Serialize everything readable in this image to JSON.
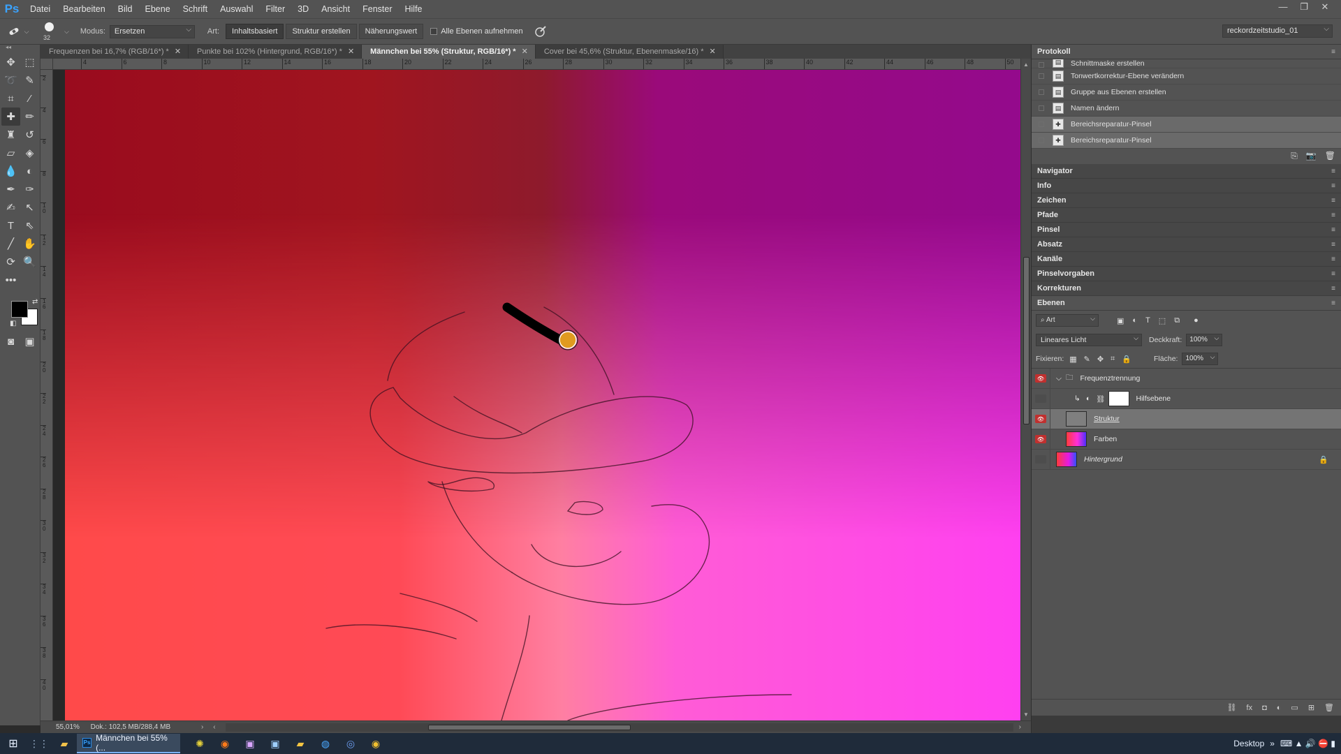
{
  "app": {
    "logo": "Ps"
  },
  "menu": [
    "Datei",
    "Bearbeiten",
    "Bild",
    "Ebene",
    "Schrift",
    "Auswahl",
    "Filter",
    "3D",
    "Ansicht",
    "Fenster",
    "Hilfe"
  ],
  "window_controls": [
    "—",
    "❐",
    "✕"
  ],
  "options": {
    "brush_size": "32",
    "mode_label": "Modus:",
    "mode_value": "Ersetzen",
    "type_label": "Art:",
    "type_buttons": [
      "Inhaltsbasiert",
      "Struktur erstellen",
      "Näherungswert"
    ],
    "active_type": "Inhaltsbasiert",
    "sample_all_label": "Alle Ebenen aufnehmen",
    "workspace": "reckordzeitstudio_01"
  },
  "tabs": [
    {
      "label": "Frequenzen bei 16,7% (RGB/16*) *",
      "active": false
    },
    {
      "label": "Punkte bei 102% (Hintergrund, RGB/16*) *",
      "active": false
    },
    {
      "label": "Männchen bei 55% (Struktur, RGB/16*) *",
      "active": true
    },
    {
      "label": "Cover bei 45,6% (Struktur, Ebenenmaske/16) *",
      "active": false
    }
  ],
  "ruler_h": [
    "4",
    "6",
    "8",
    "10",
    "12",
    "14",
    "16",
    "18",
    "20",
    "22",
    "24",
    "26",
    "28",
    "30",
    "32",
    "34",
    "36",
    "38",
    "40",
    "42",
    "44",
    "46",
    "48",
    "50"
  ],
  "ruler_v": [
    "2",
    "4",
    "6",
    "8",
    "10",
    "12",
    "14",
    "16",
    "18",
    "20",
    "22",
    "24",
    "26",
    "28",
    "30",
    "32",
    "34",
    "36",
    "38",
    "40"
  ],
  "status": {
    "zoom": "55,01%",
    "doc": "Dok.: 102,5 MB/288,4 MB"
  },
  "history": {
    "title": "Protokoll",
    "items": [
      {
        "label": "Schnittmaske erstellen",
        "selected": false
      },
      {
        "label": "Tonwertkorrektur-Ebene verändern",
        "selected": false
      },
      {
        "label": "Gruppe aus Ebenen erstellen",
        "selected": false
      },
      {
        "label": "Namen ändern",
        "selected": false
      },
      {
        "label": "Bereichsreparatur-Pinsel",
        "selected": true
      },
      {
        "label": "Bereichsreparatur-Pinsel",
        "selected": true
      }
    ]
  },
  "collapsed_panels": [
    "Navigator",
    "Info",
    "Zeichen",
    "Pfade",
    "Pinsel",
    "Absatz",
    "Kanäle",
    "Pinselvorgaben",
    "Korrekturen"
  ],
  "layers": {
    "title": "Ebenen",
    "filter": "Art",
    "blend_mode": "Lineares Licht",
    "opacity_label": "Deckkraft:",
    "opacity": "100%",
    "lock_label": "Fixieren:",
    "fill_label": "Fläche:",
    "fill": "100%",
    "items": [
      {
        "name": "Frequenztrennung",
        "kind": "group",
        "visible": true,
        "selected": false
      },
      {
        "name": "Hilfsebene",
        "kind": "adjustment",
        "visible": false,
        "selected": false
      },
      {
        "name": "Struktur",
        "kind": "pixel",
        "visible": true,
        "selected": true
      },
      {
        "name": "Farben",
        "kind": "pixel",
        "visible": true,
        "selected": false
      },
      {
        "name": "Hintergrund",
        "kind": "background",
        "visible": false,
        "selected": false
      }
    ]
  },
  "taskbar": {
    "active_app": "Männchen bei 55% (...",
    "desktop": "Desktop"
  },
  "colors": {
    "foreground": "#000000",
    "background": "#ffffff",
    "accent": "#3aa3ff",
    "eye_red": "#c0302f"
  }
}
